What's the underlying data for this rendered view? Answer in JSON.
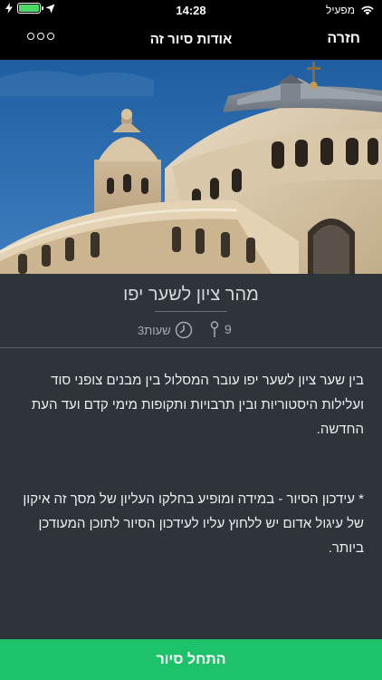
{
  "status_bar": {
    "time": "14:28",
    "carrier": "מפעיל",
    "battery_color": "#4cd964"
  },
  "nav": {
    "title": "אודות סיור זה",
    "back_label": "חזרה",
    "more_icon": "ellipsis-circles-icon"
  },
  "tour": {
    "title": "מהר ציון לשער יפו",
    "stops_count": "9",
    "duration": "3שעות",
    "description_1": "בין שער ציון לשער יפו עובר המסלול בין מבנים צופני סוד ועלילות היסטוריות ובין תרבויות ותקופות מימי קדם ועד העת החדשה.",
    "description_2": "* עידכון הסיור - במידה ומופיע בחלקו העליון של מסך זה איקון של עיגול אדום יש ללחוץ עליו לעידכון הסיור לתוכן המעודכן ביותר."
  },
  "footer": {
    "start_label": "התחל סיור",
    "accent_color": "#1ec26a"
  },
  "colors": {
    "background": "#2f343b",
    "nav_background": "#000000"
  }
}
